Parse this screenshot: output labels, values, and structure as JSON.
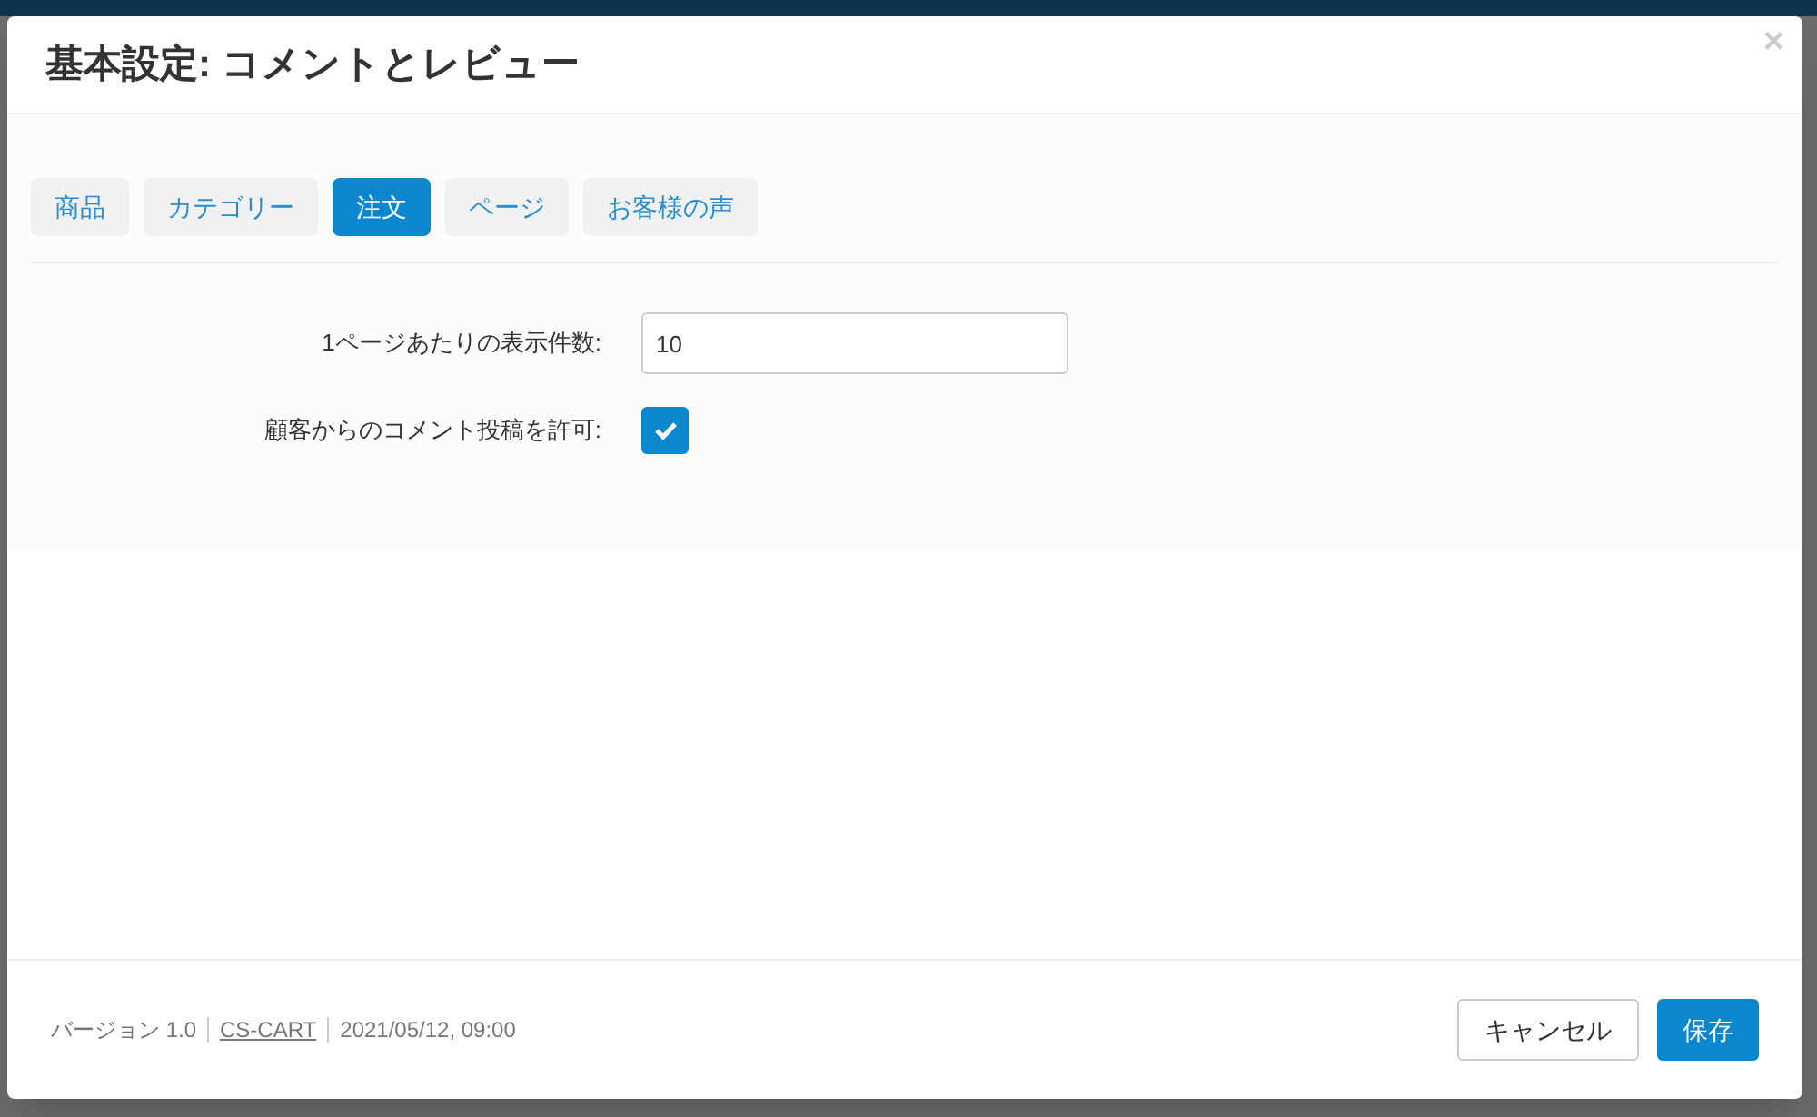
{
  "dialog": {
    "title": "基本設定: コメントとレビュー",
    "close": "×"
  },
  "tabs": [
    {
      "label": "商品",
      "selected": false
    },
    {
      "label": "カテゴリー",
      "selected": false
    },
    {
      "label": "注文",
      "selected": true
    },
    {
      "label": "ページ",
      "selected": false
    },
    {
      "label": "お客様の声",
      "selected": false
    }
  ],
  "settings": [
    {
      "kind": "text",
      "label": "1ページあたりの表示件数:",
      "value": "10"
    },
    {
      "kind": "checkbox",
      "label": "顧客からのコメント投稿を許可:",
      "checked": true
    }
  ],
  "footer": {
    "version": "バージョン 1.0",
    "link": "CS-CART",
    "date": "2021/05/12, 09:00"
  },
  "buttons": [
    {
      "label": "キャンセル",
      "kind": "secondary"
    },
    {
      "label": "保存",
      "kind": "primary"
    }
  ]
}
